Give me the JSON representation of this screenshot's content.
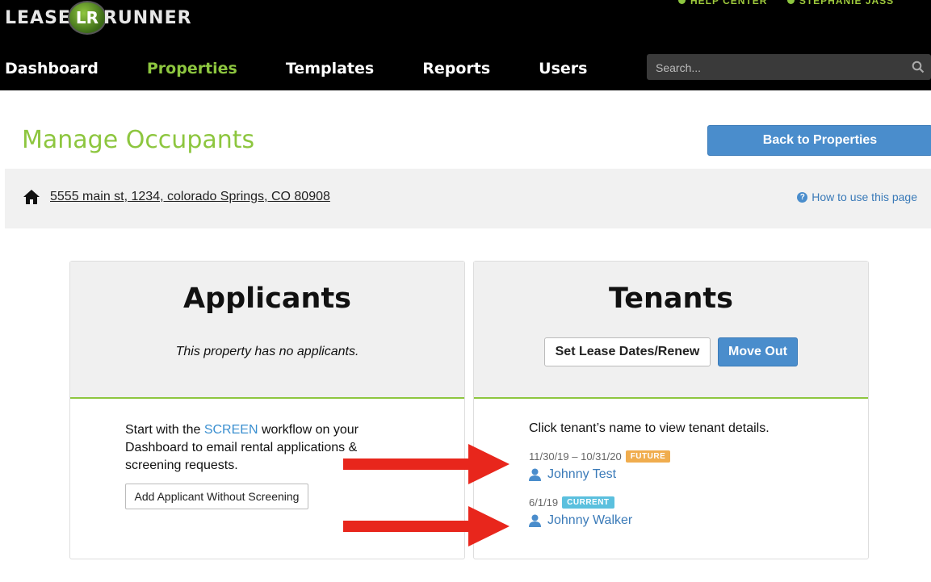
{
  "header": {
    "logo_left": "LEASE",
    "logo_badge": "LR",
    "logo_right": "RUNNER",
    "help_center": "HELP CENTER",
    "user_name": "STEPHANIE JASS"
  },
  "nav": {
    "items": [
      {
        "label": "Dashboard",
        "active": false
      },
      {
        "label": "Properties",
        "active": true
      },
      {
        "label": "Templates",
        "active": false
      },
      {
        "label": "Reports",
        "active": false
      },
      {
        "label": "Users",
        "active": false
      }
    ],
    "search_placeholder": "Search..."
  },
  "page": {
    "title": "Manage Occupants",
    "back_button": "Back to Properties",
    "address": "5555 main st, 1234, colorado Springs, CO 80908",
    "how_to": "How to use this page"
  },
  "applicants": {
    "title": "Applicants",
    "note": "This property has no applicants.",
    "intro_before": "Start with the ",
    "intro_link": "SCREEN",
    "intro_after": " workflow on your Dashboard to email rental applications & screening requests.",
    "add_button": "Add Applicant Without Screening"
  },
  "tenants": {
    "title": "Tenants",
    "lease_button": "Set Lease Dates/Renew",
    "move_out_button": "Move Out",
    "intro": "Click tenant’s name to view tenant details.",
    "list": [
      {
        "dates": "11/30/19 – 10/31/20",
        "badge": "FUTURE",
        "badge_color": "#f0ad4e",
        "name": "Johnny Test"
      },
      {
        "dates": "6/1/19",
        "badge": "CURRENT",
        "badge_color": "#5bc0de",
        "name": "Johnny Walker"
      }
    ]
  },
  "colors": {
    "brand_green": "#8dc63f",
    "primary_blue": "#4a8dcc",
    "annotation_arrow": "#e8261c"
  }
}
